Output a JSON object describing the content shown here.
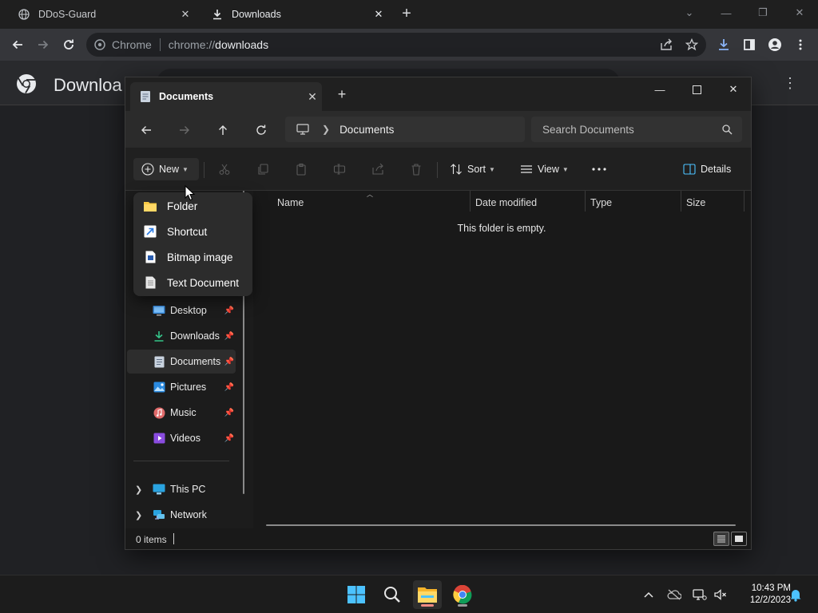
{
  "chrome": {
    "tabs": [
      {
        "title": "DDoS-Guard",
        "favicon": "globe-icon"
      },
      {
        "title": "Downloads",
        "favicon": "download-icon"
      }
    ],
    "omnibox": {
      "chip": "Chrome",
      "url_scheme": "chrome://",
      "url_host": "downloads"
    },
    "page_title": "Downloa"
  },
  "explorer": {
    "tab_title": "Documents",
    "breadcrumb": "Documents",
    "search_placeholder": "Search Documents",
    "command_bar": {
      "new_label": "New",
      "sort_label": "Sort",
      "view_label": "View",
      "details_label": "Details"
    },
    "new_menu": [
      {
        "label": "Folder",
        "icon": "folder-icon"
      },
      {
        "label": "Shortcut",
        "icon": "shortcut-icon"
      },
      {
        "label": "Bitmap image",
        "icon": "bitmap-icon"
      },
      {
        "label": "Text Document",
        "icon": "text-document-icon"
      }
    ],
    "nav_items": [
      {
        "label": "Desktop",
        "icon": "desktop-icon",
        "pinned": true
      },
      {
        "label": "Downloads",
        "icon": "download-icon",
        "pinned": true
      },
      {
        "label": "Documents",
        "icon": "document-icon",
        "pinned": true,
        "selected": true
      },
      {
        "label": "Pictures",
        "icon": "pictures-icon",
        "pinned": true
      },
      {
        "label": "Music",
        "icon": "music-icon",
        "pinned": true
      },
      {
        "label": "Videos",
        "icon": "videos-icon",
        "pinned": true
      }
    ],
    "nav_roots": [
      {
        "label": "This PC",
        "icon": "this-pc-icon"
      },
      {
        "label": "Network",
        "icon": "network-icon"
      }
    ],
    "columns": [
      "Name",
      "Date modified",
      "Type",
      "Size"
    ],
    "empty_message": "This folder is empty.",
    "status": "0 items"
  },
  "taskbar": {
    "time": "10:43 PM",
    "date": "12/2/2023"
  },
  "colors": {
    "accent_blue": "#4cc2ff",
    "folder_yellow": "#f8c944",
    "active_indicator": "#f28b82"
  }
}
